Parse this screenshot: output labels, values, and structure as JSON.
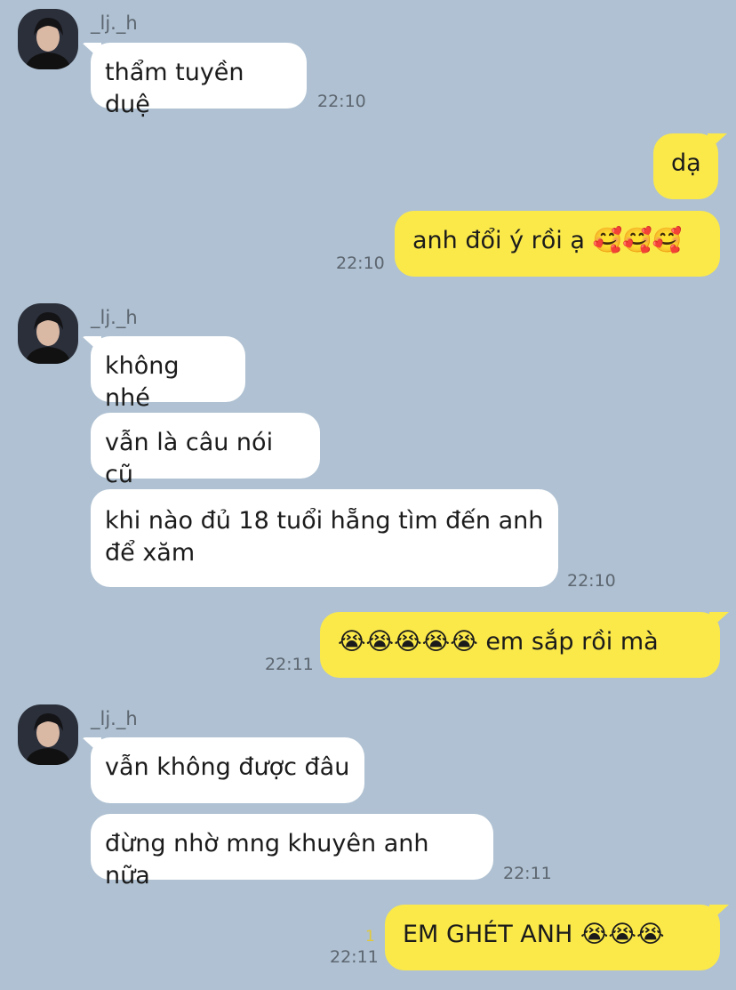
{
  "contact": {
    "name": "_lj._h"
  },
  "avatar": {
    "icon": "profile-photo-icon"
  },
  "messages": [
    {
      "dir": "in",
      "text": "thẩm tuyền duệ",
      "time": "22:10"
    },
    {
      "dir": "out",
      "text": "dạ"
    },
    {
      "dir": "out",
      "text": "anh đổi ý rồi ạ 🥰🥰🥰",
      "time": "22:10"
    },
    {
      "dir": "in",
      "text": "không nhé"
    },
    {
      "dir": "in",
      "text": "vẫn là câu nói cũ"
    },
    {
      "dir": "in",
      "text": "khi nào đủ 18 tuổi hẵng tìm đến anh\nđể xăm",
      "time": "22:10"
    },
    {
      "dir": "out",
      "text": "😭😭😭😭😭 em sắp rồi mà",
      "time": "22:11"
    },
    {
      "dir": "in",
      "text": "vẫn không được đâu"
    },
    {
      "dir": "in",
      "text": "đừng nhờ mng khuyên anh nữa",
      "time": "22:11"
    },
    {
      "dir": "out",
      "text": "EM GHÉT ANH 😭😭😭",
      "time": "22:11",
      "unread": "1"
    }
  ],
  "colors": {
    "background": "#afc1d2",
    "outgoing": "#fbe94a",
    "incoming": "#ffffff",
    "unread": "#e2c93a"
  }
}
